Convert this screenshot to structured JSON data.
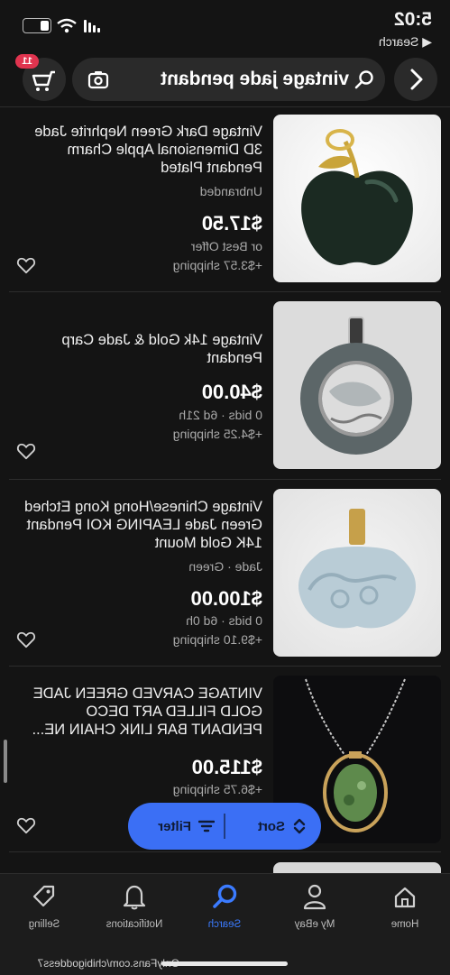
{
  "status_bar": {
    "time": "5:02",
    "back_label": "◀ Search"
  },
  "header": {
    "search_query": "vintage jade pendant",
    "cart_count": "11"
  },
  "listings": [
    {
      "title": "Vintage Dark Green Nephrite Jade 3D Dimensional Apple Charm Pendant Plated",
      "subtitle": "Unbranded",
      "price": "$17.50",
      "line1": "or Best Offer",
      "shipping": "+$3.57 shipping"
    },
    {
      "title": "Vintage 14k Gold & Jade Carp Pendant",
      "subtitle": "",
      "price": "$40.00",
      "line1": "0 bids · 6d 21h",
      "shipping": "+$4.25 shipping"
    },
    {
      "title": "Vintage Chinese/Hong Kong Etched Green Jade LEAPING KOI Pendant 14K Gold Mount",
      "subtitle": "Jade · Green",
      "price": "$100.00",
      "line1": "0 bids · 6d 0h",
      "shipping": "+$9.10 shipping"
    },
    {
      "title": "VINTAGE CARVED GREEN JADE GOLD FILLED ART DECO PENDANT BAR LINK CHAIN NE...",
      "subtitle": "",
      "price": "$115.00",
      "line1": "",
      "shipping": "+$6.75 shipping"
    }
  ],
  "sort_filter": {
    "sort_label": "Sort",
    "filter_label": "Filter"
  },
  "bottom_nav": {
    "home": "Home",
    "my_ebay": "My eBay",
    "search": "Search",
    "notifications": "Notifications",
    "selling": "Selling",
    "active_color": "#3b7bff"
  },
  "watermark_url": "OnlyFans.com/chibigoddess7"
}
